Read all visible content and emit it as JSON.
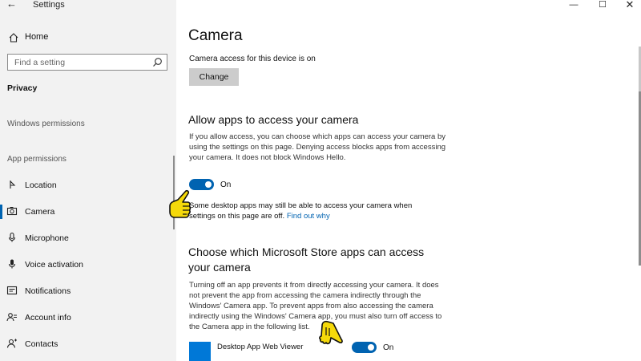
{
  "window": {
    "title": "Settings",
    "back_icon": "back-arrow-icon",
    "controls": {
      "minimize": "—",
      "maximize": "☐",
      "close": "✕"
    }
  },
  "sidebar": {
    "home_label": "Home",
    "search_placeholder": "Find a setting",
    "section_title": "Privacy",
    "windows_permissions_header": "Windows permissions",
    "app_permissions_header": "App permissions",
    "items": [
      {
        "label": "Location",
        "icon": "location-icon",
        "active": false
      },
      {
        "label": "Camera",
        "icon": "camera-icon",
        "active": true
      },
      {
        "label": "Microphone",
        "icon": "microphone-icon",
        "active": false
      },
      {
        "label": "Voice activation",
        "icon": "voice-activation-icon",
        "active": false
      },
      {
        "label": "Notifications",
        "icon": "notifications-icon",
        "active": false
      },
      {
        "label": "Account info",
        "icon": "account-info-icon",
        "active": false
      },
      {
        "label": "Contacts",
        "icon": "contacts-icon",
        "active": false
      }
    ]
  },
  "main": {
    "title": "Camera",
    "device_status": "Camera access for this device is on",
    "change_button": "Change",
    "allow_apps": {
      "heading": "Allow apps to access your camera",
      "description": "If you allow access, you can choose which apps can access your camera by using the settings on this page. Denying access blocks apps from accessing your camera. It does not block Windows Hello.",
      "toggle_state": "On",
      "toggle_on": true
    },
    "note": {
      "text": "Some desktop apps may still be able to access your camera when settings on this page are off. ",
      "link": "Find out why"
    },
    "store_apps": {
      "heading": "Choose which Microsoft Store apps can access your camera",
      "description": "Turning off an app prevents it from directly accessing your camera. It does not prevent the app from accessing the camera indirectly through the Windows' Camera app. To prevent apps from also accessing the camera indirectly using the Windows' Camera app, you must also turn off access to the Camera app in the following list.",
      "apps": [
        {
          "name": "Desktop App Web Viewer",
          "toggle_state": "On",
          "toggle_on": true
        }
      ]
    }
  },
  "colors": {
    "accent": "#0063b1",
    "sidebar_bg": "#f2f2f2",
    "button_bg": "#cccccc",
    "hand_pointer": "#f5d90a"
  }
}
